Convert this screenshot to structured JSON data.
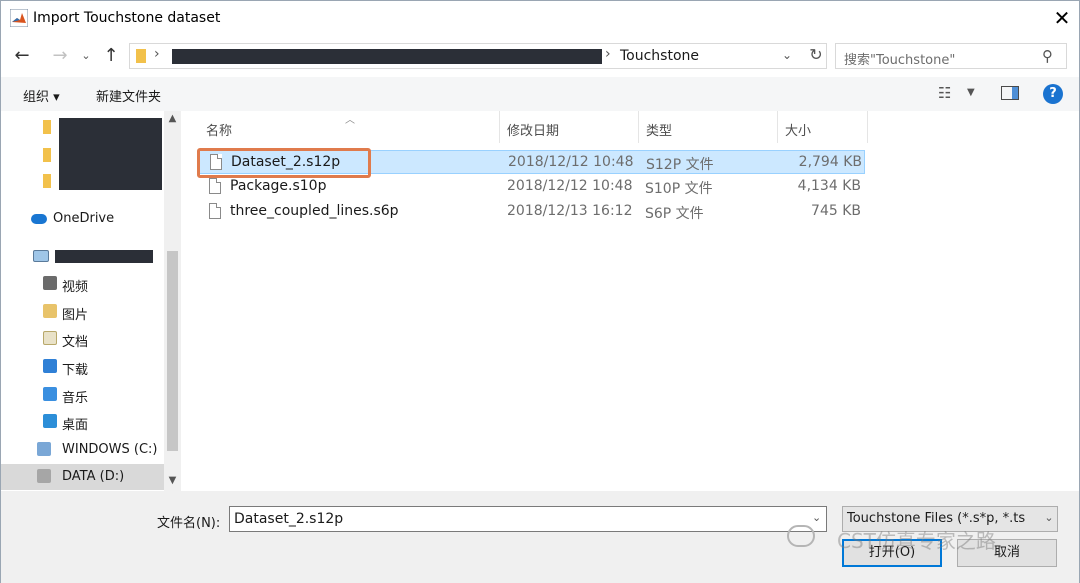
{
  "window": {
    "title": "Import Touchstone dataset",
    "close_glyph": "✕"
  },
  "nav": {
    "back_glyph": "←",
    "forward_glyph": "→",
    "recent_glyph": "⌄",
    "up_glyph": "↑",
    "crumb": "Touchstone",
    "sep_glyph": "›",
    "refresh_glyph": "↻"
  },
  "search": {
    "placeholder": "搜索\"Touchstone\""
  },
  "toolbar": {
    "organize": "组织 ▾",
    "new_folder": "新建文件夹",
    "help_glyph": "?"
  },
  "navpane": {
    "items": [
      {
        "label": "OneDrive"
      },
      {
        "label": "视频"
      },
      {
        "label": "图片"
      },
      {
        "label": "文档"
      },
      {
        "label": "下载"
      },
      {
        "label": "音乐"
      },
      {
        "label": "桌面"
      },
      {
        "label": "WINDOWS (C:)"
      },
      {
        "label": "DATA (D:)"
      }
    ]
  },
  "filelist": {
    "columns": {
      "name": "名称",
      "date": "修改日期",
      "type": "类型",
      "size": "大小"
    },
    "rows": [
      {
        "name": "Dataset_2.s12p",
        "date": "2018/12/12 10:48",
        "type": "S12P 文件",
        "size": "2,794 KB"
      },
      {
        "name": "Package.s10p",
        "date": "2018/12/12 10:48",
        "type": "S10P 文件",
        "size": "4,134 KB"
      },
      {
        "name": "three_coupled_lines.s6p",
        "date": "2018/12/13 16:12",
        "type": "S6P 文件",
        "size": "745 KB"
      }
    ]
  },
  "bottom": {
    "filename_label": "文件名(N):",
    "filename_value": "Dataset_2.s12p",
    "filter_value": "Touchstone Files (*.s*p, *.ts",
    "open_label": "打开(O)",
    "cancel_label": "取消"
  },
  "watermark": {
    "text": "CST仿真专家之路"
  },
  "colors": {
    "selection": "#cce8ff",
    "highlight_border": "#e07b4c",
    "accent": "#0078d7"
  }
}
